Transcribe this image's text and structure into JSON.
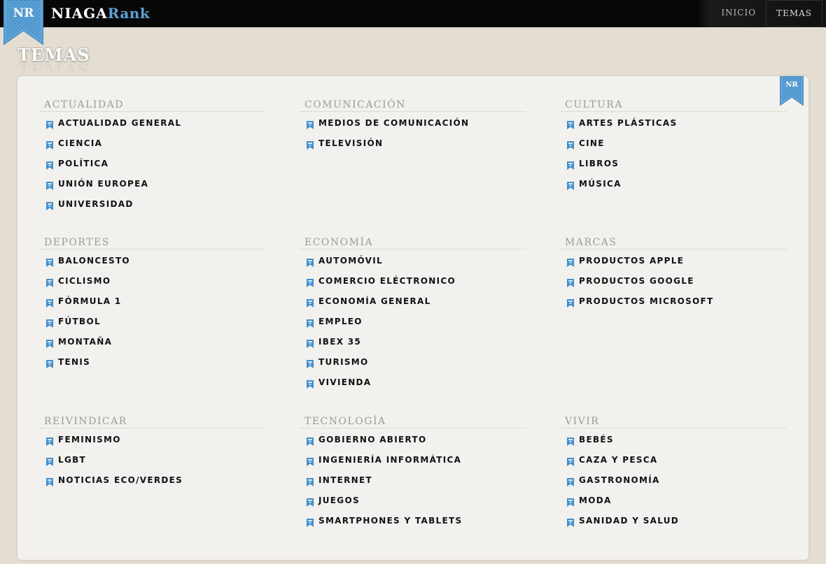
{
  "header": {
    "logo_text": "NR",
    "brand_part1": "NIAGA",
    "brand_part2": "Rank",
    "nav": [
      {
        "label": "INICIO"
      },
      {
        "label": "TEMAS"
      }
    ]
  },
  "page_title": "TEMAS",
  "colors": {
    "accent": "#5aa3d8",
    "topbar": "#070707",
    "background": "#e4ddd2",
    "panel": "#f3f1ed"
  },
  "icons": {
    "item_icon": "bookmark-ribbon-icon"
  },
  "sections": [
    {
      "title": "ACTUALIDAD",
      "items": [
        "ACTUALIDAD GENERAL",
        "CIENCIA",
        "POLÍTICA",
        "UNIÓN EUROPEA",
        "UNIVERSIDAD"
      ]
    },
    {
      "title": "COMUNICACIÓN",
      "items": [
        "MEDIOS DE COMUNICACIÓN",
        "TELEVISIÓN"
      ]
    },
    {
      "title": "CULTURA",
      "items": [
        "ARTES PLÁSTICAS",
        "CINE",
        "LIBROS",
        "MÚSICA"
      ]
    },
    {
      "title": "DEPORTES",
      "items": [
        "BALONCESTO",
        "CICLISMO",
        "FÓRMULA 1",
        "FÚTBOL",
        "MONTAÑA",
        "TENIS"
      ]
    },
    {
      "title": "ECONOMÍA",
      "items": [
        "AUTOMÓVIL",
        "COMERCIO ELÉCTRONICO",
        "ECONOMÍA GENERAL",
        "EMPLEO",
        "IBEX 35",
        "TURISMO",
        "VIVIENDA"
      ]
    },
    {
      "title": "MARCAS",
      "items": [
        "PRODUCTOS APPLE",
        "PRODUCTOS GOOGLE",
        "PRODUCTOS MICROSOFT"
      ]
    },
    {
      "title": "REIVINDICAR",
      "items": [
        "FEMINISMO",
        "LGBT",
        "NOTICIAS ECO/VERDES"
      ]
    },
    {
      "title": "TECNOLOGÍA",
      "items": [
        "GOBIERNO ABIERTO",
        "INGENIERÍA INFORMÁTICA",
        "INTERNET",
        "JUEGOS",
        "SMARTPHONES Y TABLETS"
      ]
    },
    {
      "title": "VIVIR",
      "items": [
        "BEBÉS",
        "CAZA Y PESCA",
        "GASTRONOMÍA",
        "MODA",
        "SANIDAD Y SALUD"
      ]
    }
  ]
}
